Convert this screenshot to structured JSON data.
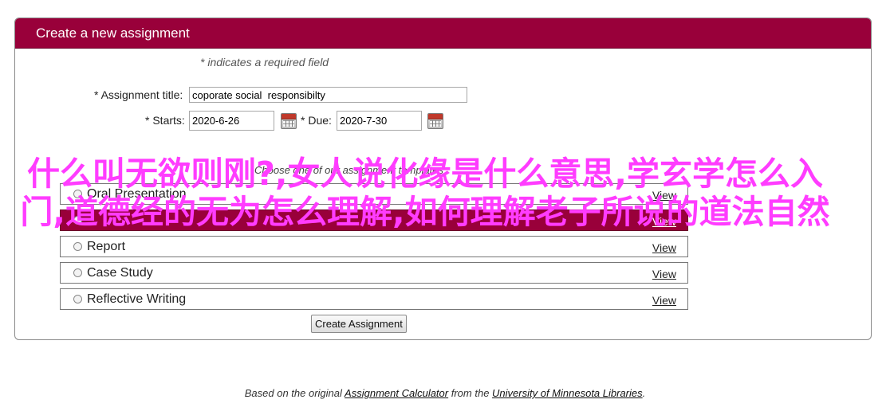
{
  "header": {
    "title": "Create a new assignment"
  },
  "form": {
    "required_note": "* indicates a required field",
    "title_label": "* Assignment title:",
    "title_value": "coporate social  responsibilty",
    "starts_label": "* Starts:",
    "starts_value": "2020-6-26",
    "due_label": "* Due:",
    "due_value": "2020-7-30",
    "template_hint": "Choose one of our assignment templates",
    "templates": [
      {
        "name": "Oral Presentation",
        "view": "View"
      },
      {
        "name": "",
        "view": "View"
      },
      {
        "name": "Report",
        "view": "View"
      },
      {
        "name": "Case Study",
        "view": "View"
      },
      {
        "name": "Reflective Writing",
        "view": "View"
      }
    ],
    "create_button": "Create Assignment"
  },
  "overlay_text": "什么叫无欲则刚?,女人说化缘是什么意思,学玄学怎么入门,道德经的无为怎么理解,如何理解老子所说的道法自然",
  "footer": {
    "prefix": "Based on the original",
    "link1": "Assignment Calculator",
    "middle": "from the",
    "link2": "University of Minnesota Libraries",
    "suffix": "."
  },
  "colors": {
    "header_bg": "#99003a",
    "overlay_text": "#ff3cff"
  },
  "icons": {
    "calendar": "calendar-icon"
  }
}
